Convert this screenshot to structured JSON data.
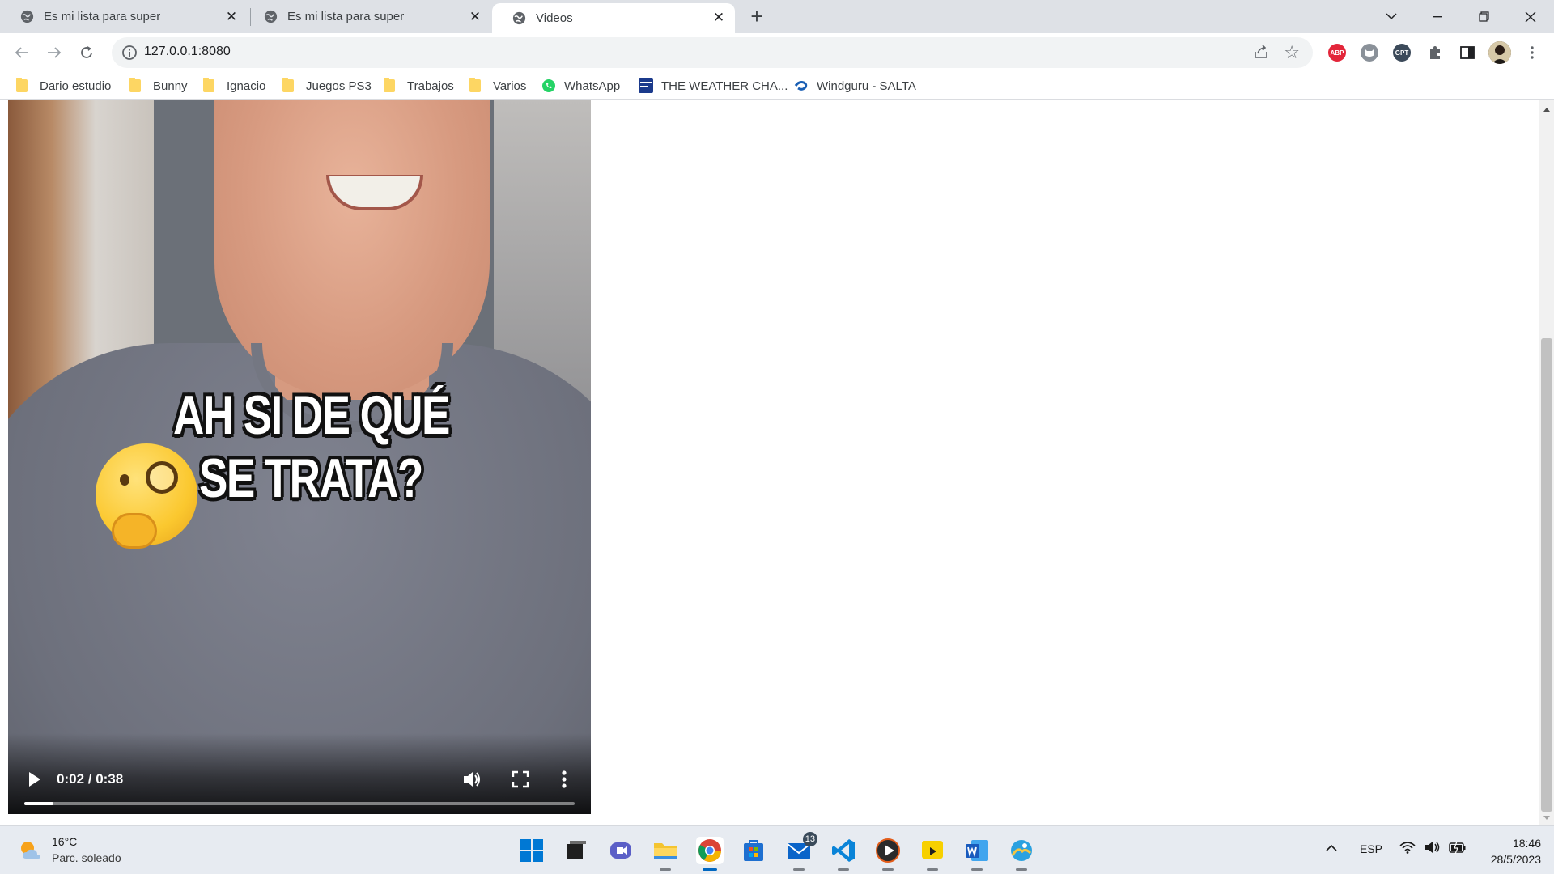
{
  "browser": {
    "tabs": [
      {
        "title": "Es mi lista para super",
        "active": false
      },
      {
        "title": "Es mi lista para super",
        "active": false
      },
      {
        "title": "Videos",
        "active": true
      }
    ],
    "url": "127.0.0.1:8080",
    "bookmarks": [
      {
        "label": "Dario estudio",
        "icon": "folder-icon"
      },
      {
        "label": "Bunny",
        "icon": "folder-icon"
      },
      {
        "label": "Ignacio",
        "icon": "folder-icon"
      },
      {
        "label": "Juegos PS3",
        "icon": "folder-icon"
      },
      {
        "label": "Trabajos",
        "icon": "folder-icon"
      },
      {
        "label": "Varios",
        "icon": "folder-icon"
      },
      {
        "label": "WhatsApp",
        "icon": "whatsapp-icon"
      },
      {
        "label": "THE WEATHER CHA...",
        "icon": "weather-channel-icon"
      },
      {
        "label": "Windguru - SALTA",
        "icon": "windguru-icon"
      }
    ],
    "extensions": [
      {
        "name": "adblock-plus-icon",
        "text": "ABP",
        "color": "#e3263a"
      },
      {
        "name": "cat-extension-icon",
        "text": "",
        "color": "#8a9199"
      },
      {
        "name": "chatgpt-extension-icon",
        "text": "GPT",
        "color": "#3c4a5a"
      }
    ]
  },
  "video": {
    "caption_line1": "AH SI DE QUÉ",
    "caption_line2": "SE TRATA?",
    "time_display": "0:02 / 0:38",
    "progress_fraction": 0.053
  },
  "taskbar": {
    "weather_temp": "16°C",
    "weather_condition": "Parc. soleado",
    "apps": [
      {
        "name": "start-menu-icon",
        "color": "#0078d4",
        "running": false
      },
      {
        "name": "task-view-icon",
        "color": "#1f1f1f",
        "running": false
      },
      {
        "name": "teams-chat-icon",
        "color": "#5b5fc7",
        "running": false
      },
      {
        "name": "file-explorer-icon",
        "color": "#f4c430",
        "running": true
      },
      {
        "name": "chrome-icon",
        "color": "#db4437",
        "running": true,
        "active": true
      },
      {
        "name": "microsoft-store-icon",
        "color": "#1e6fd0",
        "running": false
      },
      {
        "name": "mail-icon",
        "color": "#0a64c9",
        "running": true,
        "badge": "13"
      },
      {
        "name": "vscode-icon",
        "color": "#0a84d8",
        "running": true
      },
      {
        "name": "media-player-icon",
        "color": "#2b2b2b",
        "running": true
      },
      {
        "name": "slides-player-icon",
        "color": "#f7d000",
        "running": true
      },
      {
        "name": "word-icon",
        "color": "#185abd",
        "running": true
      },
      {
        "name": "photos-icon",
        "color": "#2aa1e0",
        "running": true
      }
    ],
    "language": "ESP",
    "time": "18:46",
    "date": "28/5/2023"
  }
}
